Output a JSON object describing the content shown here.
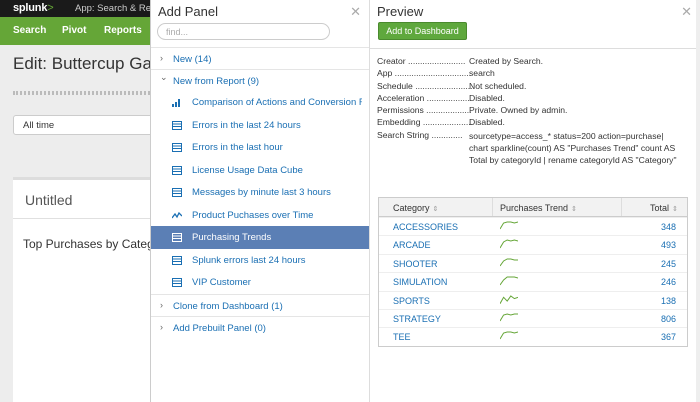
{
  "topbar": {
    "logo": "splunk",
    "logo_suffix": ">",
    "app_menu": "App: Search & Repo"
  },
  "nav": {
    "items": [
      "Search",
      "Pivot",
      "Reports"
    ]
  },
  "background": {
    "edit_title": "Edit: Buttercup Ga",
    "time_picker": "All time",
    "panel_title": "Untitled",
    "panel_heading": "Top Purchases by Categ"
  },
  "add_panel": {
    "title": "Add Panel",
    "search_placeholder": "find...",
    "groups": [
      {
        "chevron": "›",
        "label": "New (14)"
      },
      {
        "chevron": "⌄",
        "label": "New from Report (9)"
      }
    ],
    "reports": [
      {
        "label": "Comparison of Actions and Conversion R...",
        "icon": "bar-chart-icon"
      },
      {
        "label": "Errors in the last 24 hours",
        "icon": "table-icon"
      },
      {
        "label": "Errors in the last hour",
        "icon": "table-icon"
      },
      {
        "label": "License Usage Data Cube",
        "icon": "table-icon"
      },
      {
        "label": "Messages by minute last 3 hours",
        "icon": "table-icon"
      },
      {
        "label": "Product Puchases over Time",
        "icon": "line-chart-icon"
      },
      {
        "label": "Purchasing Trends",
        "icon": "table-icon",
        "selected": true
      },
      {
        "label": "Splunk errors last 24 hours",
        "icon": "table-icon"
      },
      {
        "label": "VIP Customer",
        "icon": "table-icon"
      }
    ],
    "bottom_groups": [
      {
        "chevron": "›",
        "label": "Clone from Dashboard (1)"
      },
      {
        "chevron": "›",
        "label": "Add Prebuilt Panel (0)"
      }
    ]
  },
  "preview": {
    "title": "Preview",
    "add_button": "Add to Dashboard",
    "meta": [
      {
        "key": "Creator ........................",
        "value": "Created by Search."
      },
      {
        "key": "App ................................",
        "value": "search"
      },
      {
        "key": "Schedule ........................",
        "value": "Not scheduled."
      },
      {
        "key": "Acceleration ..................",
        "value": "Disabled."
      },
      {
        "key": "Permissions ...................",
        "value": "Private. Owned by admin."
      },
      {
        "key": "Embedding .....................",
        "value": "Disabled."
      }
    ],
    "search_string": {
      "key": "Search String .............",
      "lines": [
        "sourcetype=access_* status=200 action=purchase|",
        "chart sparkline(count) AS \"Purchases Trend\" count AS",
        "Total by categoryId | rename categoryId AS \"Category\""
      ]
    },
    "table": {
      "columns": [
        "Category",
        "Purchases Trend",
        "Total"
      ],
      "sort_icon": "⇕",
      "rows": [
        {
          "category": "ACCESSORIES",
          "total": "348",
          "trend": [
            2,
            8,
            9,
            9,
            8,
            9
          ]
        },
        {
          "category": "ARCADE",
          "total": "493",
          "trend": [
            1,
            7,
            9,
            8,
            9,
            8
          ]
        },
        {
          "category": "SHOOTER",
          "total": "245",
          "trend": [
            2,
            7,
            9,
            9,
            8,
            8
          ]
        },
        {
          "category": "SIMULATION",
          "total": "246",
          "trend": [
            1,
            6,
            9,
            9,
            9,
            8
          ]
        },
        {
          "category": "SPORTS",
          "total": "138",
          "trend": [
            1,
            6,
            3,
            7,
            5,
            6
          ]
        },
        {
          "category": "STRATEGY",
          "total": "806",
          "trend": [
            2,
            8,
            9,
            8,
            9,
            9
          ]
        },
        {
          "category": "TEE",
          "total": "367",
          "trend": [
            2,
            8,
            9,
            9,
            8,
            9
          ]
        }
      ]
    }
  },
  "colors": {
    "accent_green": "#65a637",
    "link_blue": "#1a6fb3",
    "selected_row": "#5b7fb5"
  }
}
